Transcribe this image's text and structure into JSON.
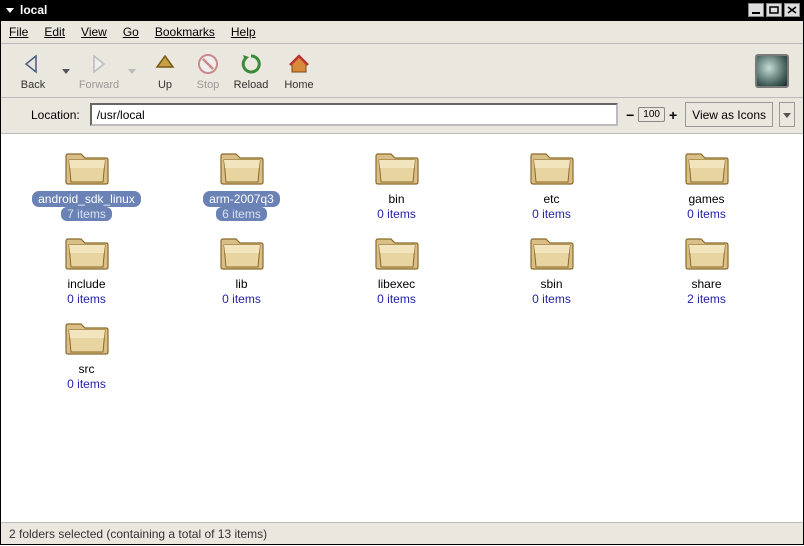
{
  "title": "local",
  "menu": {
    "file": "File",
    "edit": "Edit",
    "view": "View",
    "go": "Go",
    "bookmarks": "Bookmarks",
    "help": "Help"
  },
  "toolbar": {
    "back": "Back",
    "forward": "Forward",
    "up": "Up",
    "stop": "Stop",
    "reload": "Reload",
    "home": "Home"
  },
  "location": {
    "label": "Location:",
    "value": "/usr/local"
  },
  "zoom": {
    "value": "100"
  },
  "viewmode": {
    "label": "View as Icons"
  },
  "items": [
    {
      "name": "android_sdk_linux",
      "count": "7 items",
      "selected": true
    },
    {
      "name": "arm-2007q3",
      "count": "6 items",
      "selected": true
    },
    {
      "name": "bin",
      "count": "0 items",
      "selected": false
    },
    {
      "name": "etc",
      "count": "0 items",
      "selected": false
    },
    {
      "name": "games",
      "count": "0 items",
      "selected": false
    },
    {
      "name": "include",
      "count": "0 items",
      "selected": false
    },
    {
      "name": "lib",
      "count": "0 items",
      "selected": false
    },
    {
      "name": "libexec",
      "count": "0 items",
      "selected": false
    },
    {
      "name": "sbin",
      "count": "0 items",
      "selected": false
    },
    {
      "name": "share",
      "count": "2 items",
      "selected": false
    },
    {
      "name": "src",
      "count": "0 items",
      "selected": false
    }
  ],
  "status": "2 folders selected (containing a total of 13 items)"
}
